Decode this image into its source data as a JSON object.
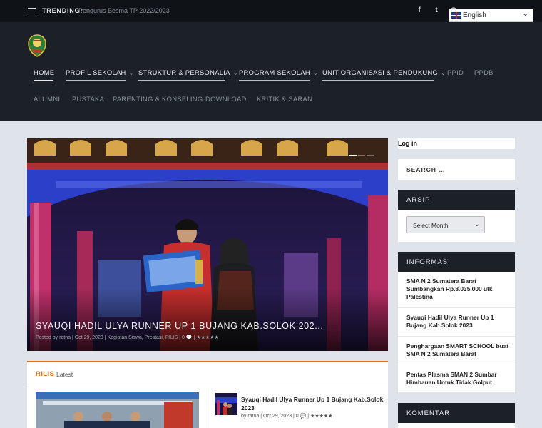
{
  "topbar": {
    "trending_label": "TRENDING:",
    "trending_text": "Pengurus Besma TP 2022/2023",
    "social": [
      {
        "icon": "facebook-icon",
        "glyph": "f"
      },
      {
        "icon": "twitter-icon",
        "glyph": "t"
      },
      {
        "icon": "rss-icon",
        "glyph": "◉"
      }
    ],
    "language": "English"
  },
  "nav": {
    "row1": [
      {
        "label": "HOME"
      },
      {
        "label": "PROFIL SEKOLAH"
      },
      {
        "label": "STRUKTUR & PERSONALIA"
      },
      {
        "label": "PROGRAM SEKOLAH"
      },
      {
        "label": "UNIT ORGANISASI & PENDUKUNG"
      },
      {
        "label": "PPID"
      },
      {
        "label": "PPDB"
      }
    ],
    "row2": [
      {
        "label": "ALUMNI"
      },
      {
        "label": "PUSTAKA"
      },
      {
        "label": "PARENTING & KONSELING"
      },
      {
        "label": "DOWNLOAD"
      },
      {
        "label": "KRITIK & SARAN"
      }
    ]
  },
  "slider": {
    "title": "SYAUQI HADIL ULYA RUNNER UP 1 BUJANG KAB.SOLOK 202...",
    "meta": "Posted by ratna | Oct 29, 2023 | Kegiatan Siswa, Prestasi, RILIS | 0 💬 | ★★★★★"
  },
  "rilis": {
    "title": "RILIS",
    "subtitle": "Latest",
    "post_title": "Syauqi Hadil Ulya Runner Up 1 Bujang Kab.Solok 2023",
    "post_meta": "by ratna | Oct 29, 2023 | 0 💬 | ★★★★★"
  },
  "sidebar": {
    "login": "Log in",
    "search_placeholder": "SEARCH …",
    "arsip_title": "ARSIP",
    "arsip_select": "Select Month",
    "informasi_title": "INFORMASI",
    "informasi_items": [
      "SMA N 2 Sumatera Barat Sumbangkan Rp.8.035.000 utk Palestina",
      "Syauqi Hadil Ulya Runner Up 1 Bujang Kab.Solok 2023",
      "Penghargaan SMART SCHOOL buat SMA N 2 Sumatera Barat",
      "Pentas Plasma SMAN 2 Sumbar Himbauan Untuk Tidak Golput"
    ],
    "komentar_title": "KOMENTAR"
  }
}
